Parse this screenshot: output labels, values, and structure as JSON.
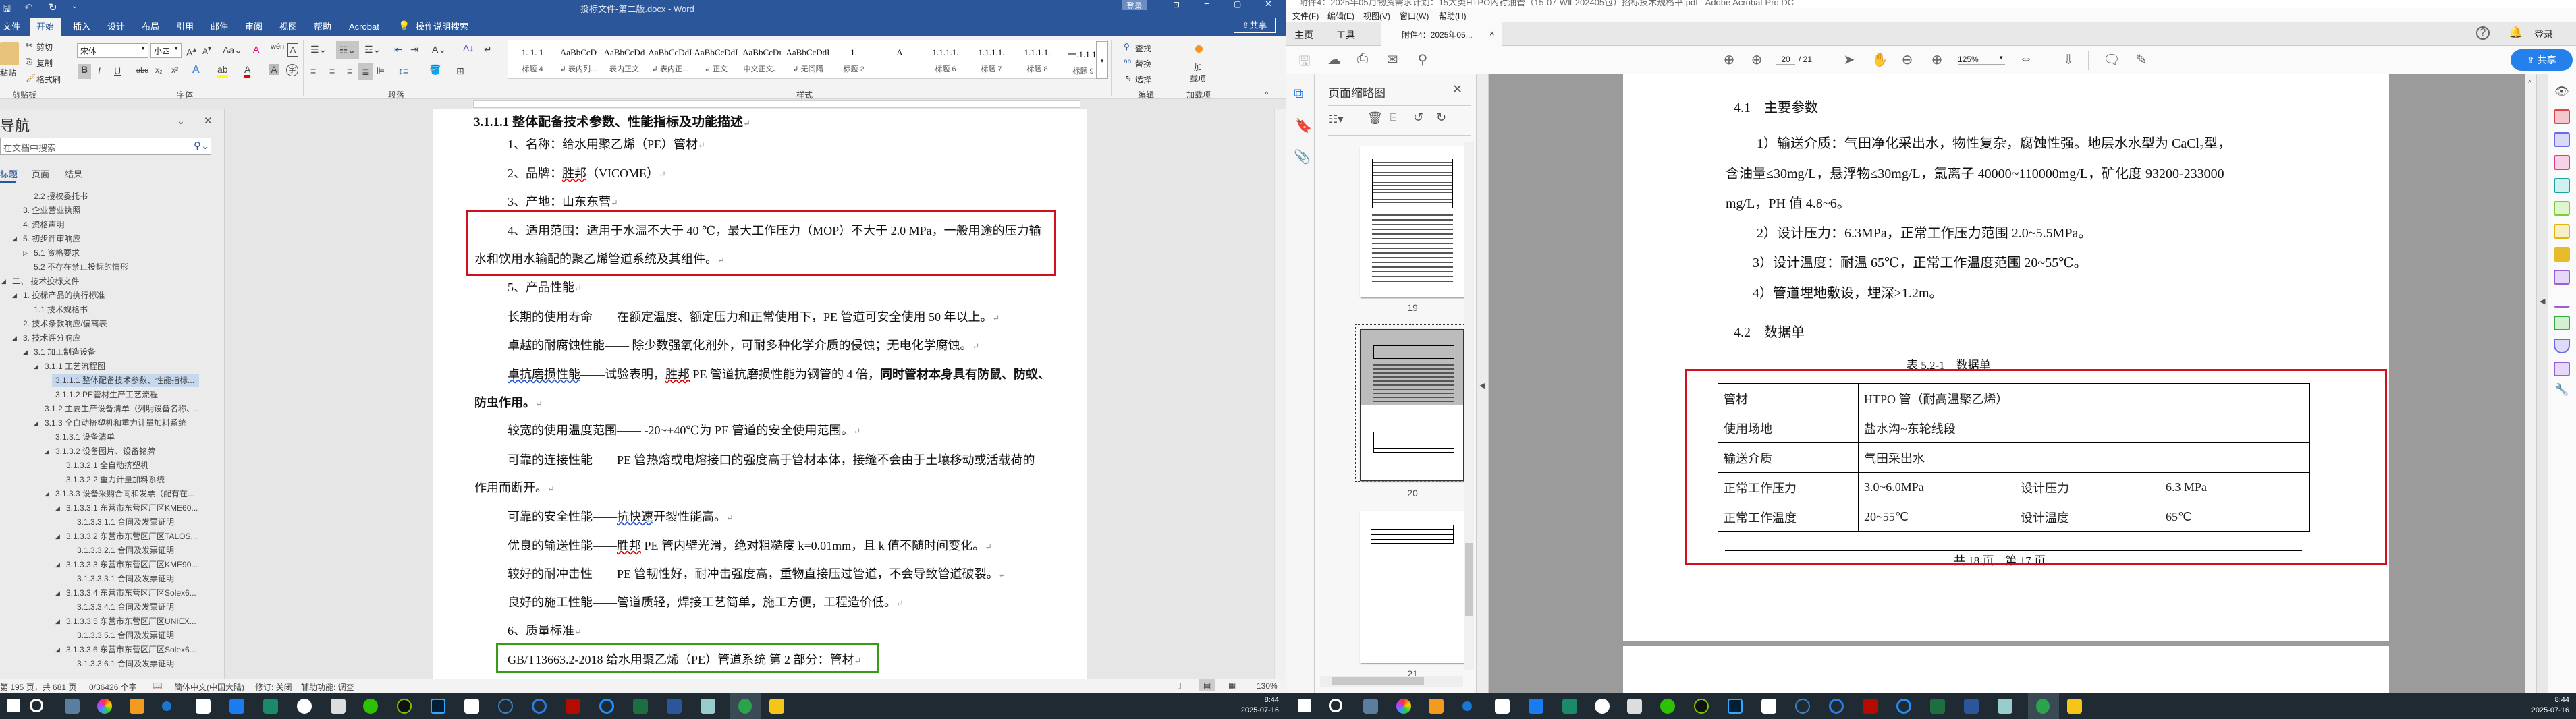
{
  "word": {
    "title": "投标文件-第二版.docx - Word",
    "login": "登录",
    "share": "共享",
    "tabs": [
      "文件",
      "开始",
      "插入",
      "设计",
      "布局",
      "引用",
      "邮件",
      "审阅",
      "视图",
      "帮助",
      "Acrobat"
    ],
    "tell_me": "操作说明搜索",
    "clipboard": {
      "paste": "粘贴",
      "cut": "剪切",
      "copy": "复制",
      "format_painter": "格式刷",
      "label": "剪贴板"
    },
    "font": {
      "name": "宋体",
      "size": "小四",
      "label": "字体"
    },
    "paragraph": {
      "label": "段落"
    },
    "styles": {
      "label": "样式",
      "items": [
        {
          "preview": "1. 1. 1",
          "name": "标题 4"
        },
        {
          "preview": "AaBbCcD",
          "name": "↲ 表内列..."
        },
        {
          "preview": "AaBbCcDd",
          "name": "表内正文"
        },
        {
          "preview": "AaBbCcDdI",
          "name": "↲ 表内正..."
        },
        {
          "preview": "AaBbCcDdI",
          "name": "↲ 正文"
        },
        {
          "preview": "AaBbCcDı",
          "name": "中文正文、"
        },
        {
          "preview": "AaBbCcDdI",
          "name": "↲ 无间隔"
        },
        {
          "preview": "1.",
          "name": "标题 2"
        },
        {
          "preview": "A",
          "name": ""
        },
        {
          "preview": "1.1.1.1.",
          "name": "标题 6"
        },
        {
          "preview": "1.1.1.1.",
          "name": "标题 7"
        },
        {
          "preview": "1.1.1.1.",
          "name": "标题 8"
        },
        {
          "preview": "一.1.1.1.",
          "name": "标题 9"
        }
      ]
    },
    "editing": {
      "find": "查找",
      "replace": "替换",
      "select": "选择",
      "label": "编辑"
    },
    "addins": {
      "button_line1": "加",
      "button_line2": "载项",
      "label": "加载项"
    },
    "nav": {
      "title": "导航",
      "search_placeholder": "在文档中搜索",
      "tabs": [
        "标题",
        "页面",
        "结果"
      ],
      "items": [
        {
          "label": "2.2 授权委托书",
          "level": 2,
          "state": ""
        },
        {
          "label": "3. 企业营业执照",
          "level": 1,
          "state": ""
        },
        {
          "label": "4. 资格声明",
          "level": 1,
          "state": ""
        },
        {
          "label": "5. 初步评审响应",
          "level": 1,
          "state": "expanded"
        },
        {
          "label": "5.1 资格要求",
          "level": 2,
          "state": "collapsed"
        },
        {
          "label": "5.2 不存在禁止投标的情形",
          "level": 2,
          "state": ""
        },
        {
          "label": "二、 技术投标文件",
          "level": 0,
          "state": "expanded"
        },
        {
          "label": "1. 投标产品的执行标准",
          "level": 1,
          "state": "expanded"
        },
        {
          "label": "1.1 技术规格书",
          "level": 2,
          "state": ""
        },
        {
          "label": "2. 技术条款响应/偏离表",
          "level": 1,
          "state": ""
        },
        {
          "label": "3. 技术评分响应",
          "level": 1,
          "state": "expanded"
        },
        {
          "label": "3.1 加工制造设备",
          "level": 2,
          "state": "expanded"
        },
        {
          "label": "3.1.1 工艺流程图",
          "level": 3,
          "state": "expanded"
        },
        {
          "label": "3.1.1.1 整体配备技术参数、性能指标...",
          "level": 4,
          "state": "",
          "selected": true
        },
        {
          "label": "3.1.1.2 PE管材生产工艺流程",
          "level": 4,
          "state": ""
        },
        {
          "label": "3.1.2 主要生产设备清单（列明设备名称、...",
          "level": 3,
          "state": ""
        },
        {
          "label": "3.1.3 全自动挤塑机和重力计量加料系统",
          "level": 3,
          "state": "expanded"
        },
        {
          "label": "3.1.3.1 设备清单",
          "level": 4,
          "state": ""
        },
        {
          "label": "3.1.3.2 设备图片、设备铭牌",
          "level": 4,
          "state": "expanded"
        },
        {
          "label": "3.1.3.2.1 全自动挤塑机",
          "level": 5,
          "state": ""
        },
        {
          "label": "3.1.3.2.2 重力计量加料系统",
          "level": 5,
          "state": ""
        },
        {
          "label": "3.1.3.3 设备采购合同和发票（配有在...",
          "level": 4,
          "state": "expanded"
        },
        {
          "label": "3.1.3.3.1 东营市东营区厂区KME60...",
          "level": 5,
          "state": "expanded"
        },
        {
          "label": "3.1.3.3.1.1 合同及发票证明",
          "level": 6,
          "state": ""
        },
        {
          "label": "3.1.3.3.2 东营市东营区厂区TALOS...",
          "level": 5,
          "state": "expanded"
        },
        {
          "label": "3.1.3.3.2.1 合同及发票证明",
          "level": 6,
          "state": ""
        },
        {
          "label": "3.1.3.3.3 东营市东营区厂区KME90...",
          "level": 5,
          "state": "expanded"
        },
        {
          "label": "3.1.3.3.3.1 合同及发票证明",
          "level": 6,
          "state": ""
        },
        {
          "label": "3.1.3.3.4 东营市东营区厂区Solex6...",
          "level": 5,
          "state": "expanded"
        },
        {
          "label": "3.1.3.3.4.1 合同及发票证明",
          "level": 6,
          "state": ""
        },
        {
          "label": "3.1.3.3.5 东营市东营区厂区UNIEX...",
          "level": 5,
          "state": "expanded"
        },
        {
          "label": "3.1.3.3.5.1 合同及发票证明",
          "level": 6,
          "state": ""
        },
        {
          "label": "3.1.3.3.6 东营市东营区厂区Solex6...",
          "level": 5,
          "state": "expanded"
        },
        {
          "label": "3.1.3.3.6.1 合同及发票证明",
          "level": 6,
          "state": ""
        }
      ]
    },
    "doc": {
      "heading": "3.1.1.1 整体配备技术参数、性能指标及功能描述",
      "l1": "1、名称：给水用聚乙烯（PE）管材",
      "l2a": "2、品牌：",
      "l2b": "胜邦",
      "l2c": "（VICOME）",
      "l3": "3、产地：山东东营",
      "l4a": "4、适用范围：适用于水温不大于 40 ℃，最大工作压力（MOP）不大于 2.0 MPa，一般用途的压力输",
      "l4b": "水和饮用水输配的聚乙烯管道系统及其组件。",
      "l5": "5、产品性能",
      "p1": "长期的使用寿命——在额定温度、额定压力和正常使用下，PE 管道可安全使用 50 年以上。",
      "p2": "卓越的耐腐蚀性能—— 除少数强氧化剂外，可耐多种化学介质的侵蚀；无电化学腐蚀。",
      "p3a": "卓抗磨损性能",
      "p3b": "——试验表明，",
      "p3c": "胜邦",
      "p3d": " PE 管道抗磨损性能为钢管的 4 倍，",
      "p3e": "同时管材本身具有防鼠、防蚁、",
      "p3f": "防虫作用。",
      "p4": "较宽的使用温度范围—— -20~+40℃为 PE 管道的安全使用范围。",
      "p5a": "可靠的连接性能——PE 管热熔或电熔接口的强度高于管材本体，接缝不会由于土壤移动或活载荷的",
      "p5b": "作用而断开。",
      "p6a": "可靠的安全性能——",
      "p6b": "抗快速",
      "p6c": "开裂性能高。",
      "p7a": "优良的输送性能——",
      "p7b": "胜邦",
      "p7c": " PE 管内壁光滑，绝对粗糙度 k=0.01mm，且 k 值不随时间变化。",
      "p8": "较好的耐冲击性——PE 管韧性好，耐冲击强度高，重物直接压过管道，不会导致管道破裂。",
      "p9": "良好的施工性能——管道质轻，焊接工艺简单，施工方便，工程造价低。",
      "l6": "6、质量标准",
      "std": "GB/T13663.2-2018 给水用聚乙烯（PE）管道系统 第 2 部分：管材",
      "para_mark": "↵"
    },
    "status": {
      "page": "第 195 页，共 681 页",
      "words": "0/36426 个字",
      "language": "简体中文(中国大陆)",
      "track": "修订: 关闭",
      "accessibility": "辅助功能: 调查",
      "zoom": "130%"
    },
    "colors": {
      "brand": "#2b579a",
      "red_box": "#d0101c",
      "green_box": "#3a9a14"
    }
  },
  "acrobat": {
    "title": "附件4：2025年05月物资需求计划：15大类HTPO内衬油管（15-07-WⅡ-202405包）招标技术规格书.pdf - Adobe Acrobat Pro DC",
    "menu": [
      "文件(F)",
      "编辑(E)",
      "视图(V)",
      "窗口(W)",
      "帮助(H)"
    ],
    "tabs": {
      "home": "主页",
      "tools": "工具",
      "doc": "附件4：2025年05...",
      "close": "×"
    },
    "login": "登录",
    "page_current": "20",
    "page_total": "/ 21",
    "zoom": "125%",
    "share": "共享",
    "thumbs": {
      "title": "页面缩略图",
      "pages": [
        "19",
        "20",
        "21"
      ]
    },
    "page": {
      "h41": "4.1　主要参数",
      "t1": "1）输送介质：气田净化采出水，物性复杂，腐蚀性强。地层水水型为 CaCl₂型，",
      "t2": "含油量≤30mg/L，悬浮物≤30mg/L，氯离子 40000~110000mg/L，矿化度 93200-233000",
      "t3": "mg/L，PH 值 4.8~6。",
      "t4": "2）设计压力：6.3MPa，正常工作压力范围 2.0~5.5MPa。",
      "t5": "3）设计温度：耐温 65℃，正常工作温度范围 20~55℃。",
      "t6": "4）管道埋地敷设，埋深≥1.2m。",
      "h42": "4.2　数据单",
      "caption": "表 5.2-1　数据单",
      "table": {
        "r1": [
          "管材",
          "HTPO 管（耐高温聚乙烯）"
        ],
        "r2": [
          "使用场地",
          "盐水沟~东轮线段"
        ],
        "r3": [
          "输送介质",
          "气田采出水"
        ],
        "r4": [
          "正常工作压力",
          "3.0~6.0MPa",
          "设计压力",
          "6.3 MPa"
        ],
        "r5": [
          "正常工作温度",
          "20~55℃",
          "设计温度",
          "65℃"
        ]
      },
      "footer": "共 18 页　第 17 页"
    },
    "colors": {
      "share_button": "#2680eb",
      "red_box": "#d0101c"
    }
  },
  "taskbar": {
    "time": "8:44",
    "date": "2025-07-16"
  }
}
